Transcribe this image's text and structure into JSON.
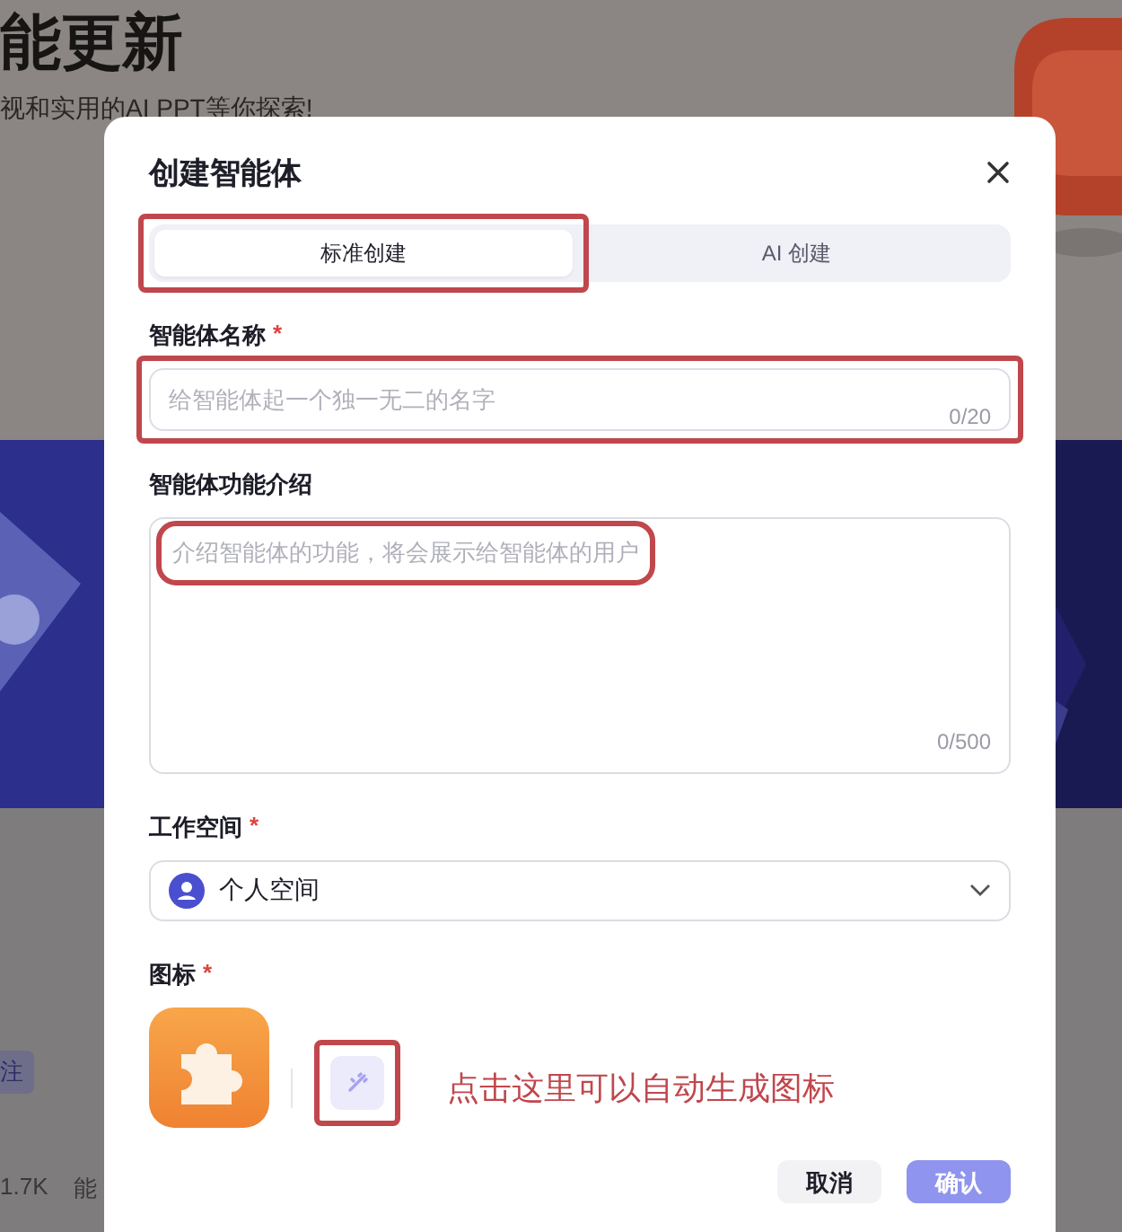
{
  "background": {
    "title": "能更新",
    "subtitle": "视和实用的AI PPT等你探索!",
    "follow_button": "注",
    "count": "1.7K",
    "label": "能"
  },
  "dialog": {
    "title": "创建智能体",
    "tabs": [
      {
        "label": "标准创建",
        "selected": true,
        "highlighted": true
      },
      {
        "label": "AI 创建",
        "selected": false,
        "highlighted": false
      }
    ],
    "fields": [
      {
        "kind": "input",
        "label": "智能体名称",
        "required_mark": "*",
        "placeholder": "给智能体起一个独一无二的名字",
        "counter": "0/20",
        "highlighted": true
      },
      {
        "kind": "textarea",
        "label": "智能体功能介绍",
        "placeholder": "介绍智能体的功能，将会展示给智能体的用户",
        "counter": "0/500",
        "highlighted": true
      },
      {
        "kind": "select",
        "label": "工作空间",
        "required_mark": "*",
        "value": "个人空间"
      },
      {
        "kind": "icon",
        "label": "图标",
        "required_mark": "*",
        "highlighted": true,
        "note": "点击这里可以自动生成图标"
      }
    ],
    "buttons": [
      {
        "label": "取消",
        "kind": "secondary"
      },
      {
        "label": "确认",
        "kind": "primary"
      }
    ]
  }
}
